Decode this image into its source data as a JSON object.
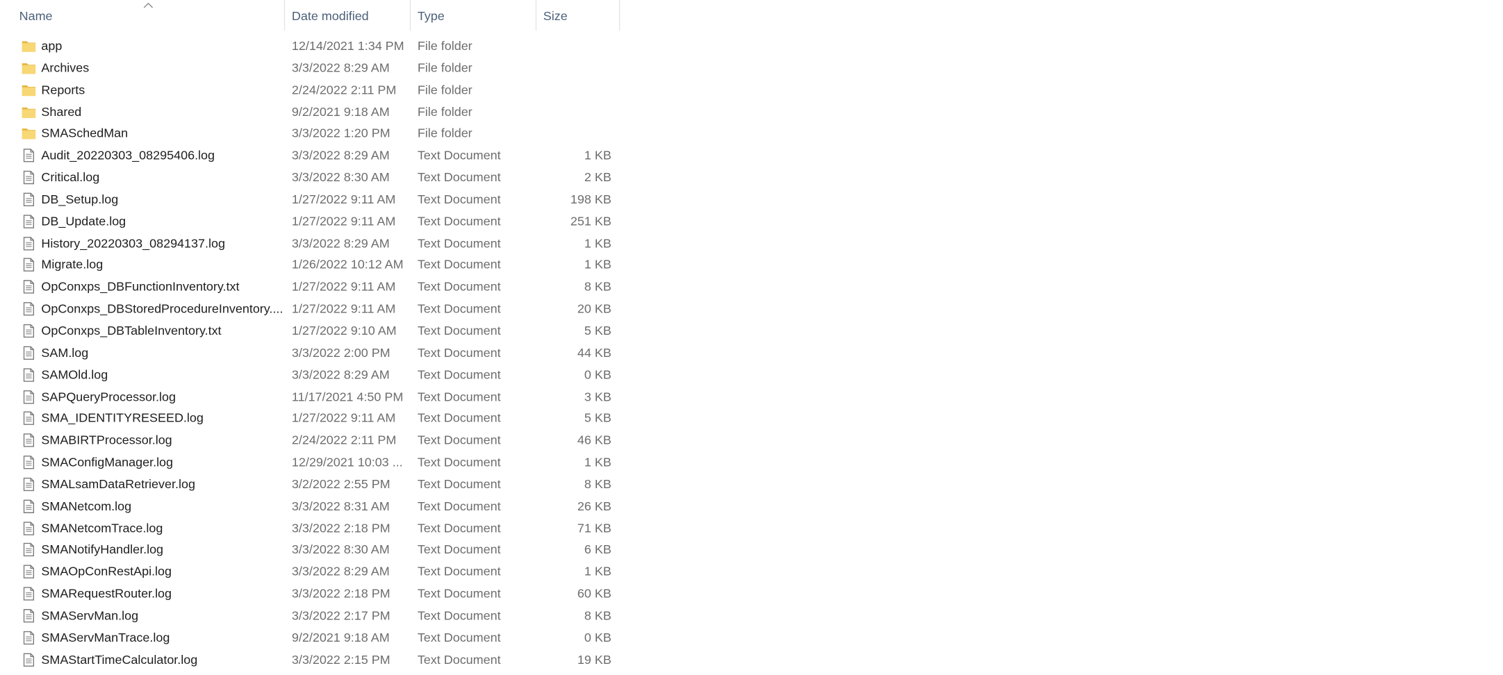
{
  "columns": {
    "name": "Name",
    "date": "Date modified",
    "type": "Type",
    "size": "Size"
  },
  "sort": {
    "column": "name",
    "direction": "ascending"
  },
  "colors": {
    "folder": "#f8d775",
    "folder_dark": "#e5b640",
    "header_text": "#4c607a",
    "row_text": "#1e1e1e",
    "meta_text": "#6d6d6d"
  },
  "files": [
    {
      "icon": "folder-icon",
      "name": "app",
      "date": "12/14/2021 1:34 PM",
      "type": "File folder",
      "size": ""
    },
    {
      "icon": "folder-icon",
      "name": "Archives",
      "date": "3/3/2022 8:29 AM",
      "type": "File folder",
      "size": ""
    },
    {
      "icon": "folder-icon",
      "name": "Reports",
      "date": "2/24/2022 2:11 PM",
      "type": "File folder",
      "size": ""
    },
    {
      "icon": "folder-icon",
      "name": "Shared",
      "date": "9/2/2021 9:18 AM",
      "type": "File folder",
      "size": ""
    },
    {
      "icon": "folder-icon",
      "name": "SMASchedMan",
      "date": "3/3/2022 1:20 PM",
      "type": "File folder",
      "size": ""
    },
    {
      "icon": "text-document-icon",
      "name": "Audit_20220303_08295406.log",
      "date": "3/3/2022 8:29 AM",
      "type": "Text Document",
      "size": "1 KB"
    },
    {
      "icon": "text-document-icon",
      "name": "Critical.log",
      "date": "3/3/2022 8:30 AM",
      "type": "Text Document",
      "size": "2 KB"
    },
    {
      "icon": "text-document-icon",
      "name": "DB_Setup.log",
      "date": "1/27/2022 9:11 AM",
      "type": "Text Document",
      "size": "198 KB"
    },
    {
      "icon": "text-document-icon",
      "name": "DB_Update.log",
      "date": "1/27/2022 9:11 AM",
      "type": "Text Document",
      "size": "251 KB"
    },
    {
      "icon": "text-document-icon",
      "name": "History_20220303_08294137.log",
      "date": "3/3/2022 8:29 AM",
      "type": "Text Document",
      "size": "1 KB"
    },
    {
      "icon": "text-document-icon",
      "name": "Migrate.log",
      "date": "1/26/2022 10:12 AM",
      "type": "Text Document",
      "size": "1 KB"
    },
    {
      "icon": "text-document-icon",
      "name": "OpConxps_DBFunctionInventory.txt",
      "date": "1/27/2022 9:11 AM",
      "type": "Text Document",
      "size": "8 KB"
    },
    {
      "icon": "text-document-icon",
      "name": "OpConxps_DBStoredProcedureInventory....",
      "date": "1/27/2022 9:11 AM",
      "type": "Text Document",
      "size": "20 KB"
    },
    {
      "icon": "text-document-icon",
      "name": "OpConxps_DBTableInventory.txt",
      "date": "1/27/2022 9:10 AM",
      "type": "Text Document",
      "size": "5 KB"
    },
    {
      "icon": "text-document-icon",
      "name": "SAM.log",
      "date": "3/3/2022 2:00 PM",
      "type": "Text Document",
      "size": "44 KB"
    },
    {
      "icon": "text-document-icon",
      "name": "SAMOld.log",
      "date": "3/3/2022 8:29 AM",
      "type": "Text Document",
      "size": "0 KB"
    },
    {
      "icon": "text-document-icon",
      "name": "SAPQueryProcessor.log",
      "date": "11/17/2021 4:50 PM",
      "type": "Text Document",
      "size": "3 KB"
    },
    {
      "icon": "text-document-icon",
      "name": "SMA_IDENTITYRESEED.log",
      "date": "1/27/2022 9:11 AM",
      "type": "Text Document",
      "size": "5 KB"
    },
    {
      "icon": "text-document-icon",
      "name": "SMABIRTProcessor.log",
      "date": "2/24/2022 2:11 PM",
      "type": "Text Document",
      "size": "46 KB"
    },
    {
      "icon": "text-document-icon",
      "name": "SMAConfigManager.log",
      "date": "12/29/2021 10:03 ...",
      "type": "Text Document",
      "size": "1 KB"
    },
    {
      "icon": "text-document-icon",
      "name": "SMALsamDataRetriever.log",
      "date": "3/2/2022 2:55 PM",
      "type": "Text Document",
      "size": "8 KB"
    },
    {
      "icon": "text-document-icon",
      "name": "SMANetcom.log",
      "date": "3/3/2022 8:31 AM",
      "type": "Text Document",
      "size": "26 KB"
    },
    {
      "icon": "text-document-icon",
      "name": "SMANetcomTrace.log",
      "date": "3/3/2022 2:18 PM",
      "type": "Text Document",
      "size": "71 KB"
    },
    {
      "icon": "text-document-icon",
      "name": "SMANotifyHandler.log",
      "date": "3/3/2022 8:30 AM",
      "type": "Text Document",
      "size": "6 KB"
    },
    {
      "icon": "text-document-icon",
      "name": "SMAOpConRestApi.log",
      "date": "3/3/2022 8:29 AM",
      "type": "Text Document",
      "size": "1 KB"
    },
    {
      "icon": "text-document-icon",
      "name": "SMARequestRouter.log",
      "date": "3/3/2022 2:18 PM",
      "type": "Text Document",
      "size": "60 KB"
    },
    {
      "icon": "text-document-icon",
      "name": "SMAServMan.log",
      "date": "3/3/2022 2:17 PM",
      "type": "Text Document",
      "size": "8 KB"
    },
    {
      "icon": "text-document-icon",
      "name": "SMAServManTrace.log",
      "date": "9/2/2021 9:18 AM",
      "type": "Text Document",
      "size": "0 KB"
    },
    {
      "icon": "text-document-icon",
      "name": "SMAStartTimeCalculator.log",
      "date": "3/3/2022 2:15 PM",
      "type": "Text Document",
      "size": "19 KB"
    }
  ]
}
